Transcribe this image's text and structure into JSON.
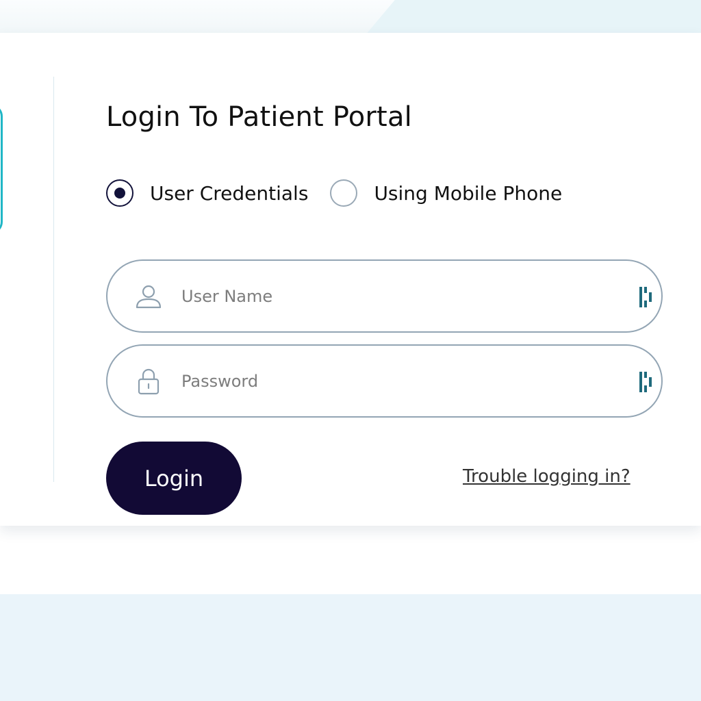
{
  "login": {
    "title": "Login To Patient Portal",
    "radio_options": [
      {
        "label": "User Credentials",
        "selected": true
      },
      {
        "label": "Using Mobile Phone",
        "selected": false
      }
    ],
    "username_placeholder": "User Name",
    "password_placeholder": "Password",
    "login_label": "Login",
    "trouble_link": "Trouble logging in?"
  },
  "icons": {
    "username": "user-icon",
    "password": "lock-icon",
    "field_addon": "password-manager-icon"
  },
  "colors": {
    "primary": "#120a35",
    "accent": "#1fb6c6",
    "field_border": "#93a5b4",
    "keypass_icon": "#1f6a7c"
  }
}
